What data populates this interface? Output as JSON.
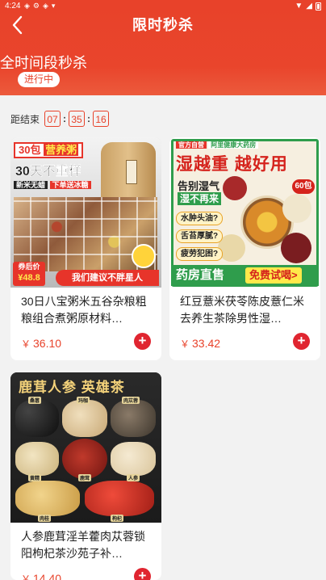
{
  "status_bar": {
    "time": "4:24"
  },
  "header": {
    "title": "限时秒杀",
    "back_icon": "chevron-left-icon"
  },
  "campaign": {
    "headline": "全时间段秒杀",
    "status": "进行中"
  },
  "countdown": {
    "label": "距结束",
    "hours": "07",
    "minutes": "35",
    "seconds": "16",
    "separator": ":"
  },
  "products": [
    {
      "name": "30日八宝粥米五谷杂粮粗粮组合煮粥原材料…",
      "currency": "￥",
      "price": "36.10",
      "image_text": {
        "line1": "30包",
        "line1b": "营养粥",
        "line2": "30天不重样",
        "line3": "新米无蜡",
        "line3b": "下单送冰糖",
        "badge_top": "券后价",
        "badge_price": "¥48.8",
        "slogan": "我们建议不胖星人"
      }
    },
    {
      "name": "红豆薏米茯苓陈皮薏仁米去养生茶除男性湿…",
      "currency": "￥",
      "price": "33.42",
      "image_text": {
        "tag1": "官方自营",
        "tag2": "阿里健康大药房",
        "headline": "湿越重 越好用",
        "sub1": "告别湿气",
        "sub2": "湿不再来",
        "bubble1": "水肿头油?",
        "bubble2": "舌苔厚腻?",
        "bubble3": "疲劳犯困?",
        "count": "60包",
        "banner_left": "药房直售",
        "banner_right": "免费试喝>"
      }
    },
    {
      "name": "人参鹿茸淫羊藿肉苁蓉锁阳枸杞茶沙苑子补…",
      "currency": "￥",
      "price": "14.40",
      "image_text": {
        "headline": "鹿茸人参 英雄茶",
        "labels": [
          "桑葚",
          "玛咖",
          "肉苁蓉",
          "黄精",
          "鹿茸",
          "人参",
          "肉桂",
          "枸杞"
        ]
      }
    }
  ],
  "colors": {
    "brand_red": "#e8422a",
    "price_red": "#e8422a",
    "add_button": "#e02530",
    "page_bg": "#f2f2f2"
  },
  "icons": {
    "add": "plus-circle-icon",
    "wifi": "wifi-icon",
    "signal": "signal-icon",
    "battery": "battery-icon"
  }
}
